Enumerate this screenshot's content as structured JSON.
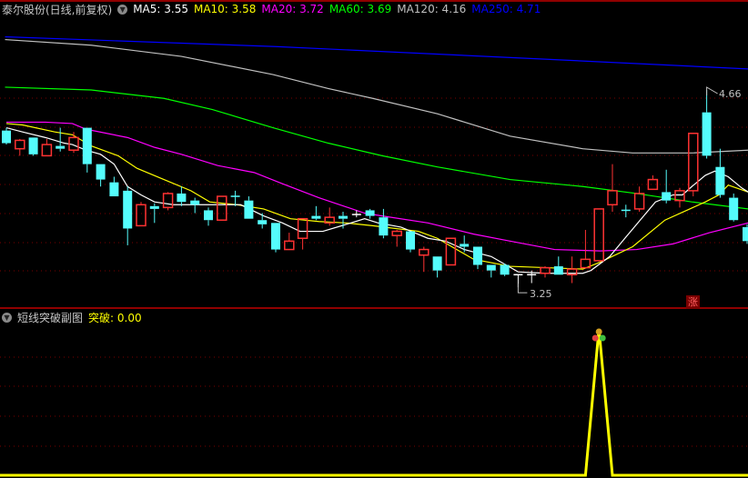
{
  "header": {
    "title": "泰尔股份(日线,前复权)",
    "indicators": [
      {
        "label": "MA5: 3.55",
        "color": "#FFFFFF"
      },
      {
        "label": "MA10: 3.58",
        "color": "#FFFF00"
      },
      {
        "label": "MA20: 3.72",
        "color": "#FF00FF"
      },
      {
        "label": "MA60: 3.69",
        "color": "#00FF00"
      },
      {
        "label": "MA120: 4.16",
        "color": "#C0C0C0"
      },
      {
        "label": "MA250: 4.71",
        "color": "#0000FF"
      }
    ]
  },
  "sub_panel": {
    "title": "短线突破副图",
    "value_label": "突破: 0.00",
    "value_color": "#FFFF00"
  },
  "annotations": {
    "high_label": "4.66",
    "low_label": "3.25",
    "rise_badge": "涨"
  },
  "colors": {
    "up": "#FF3232",
    "down": "#54FCFC",
    "doji": "#FFFFFF",
    "grid": "#7a0000",
    "separator": "#C00000"
  },
  "chart_data": {
    "type": "candlestick",
    "price_range": [
      3.25,
      4.66
    ],
    "candles": [
      [
        4.37,
        4.39,
        4.27,
        4.28
      ],
      [
        4.24,
        4.31,
        4.19,
        4.3
      ],
      [
        4.32,
        4.32,
        4.19,
        4.2
      ],
      [
        4.19,
        4.31,
        4.19,
        4.27
      ],
      [
        4.26,
        4.39,
        4.22,
        4.24
      ],
      [
        4.23,
        4.36,
        4.21,
        4.32
      ],
      [
        4.39,
        4.39,
        4.07,
        4.13
      ],
      [
        4.13,
        4.13,
        3.97,
        4.02
      ],
      [
        4.0,
        4.04,
        3.9,
        3.9
      ],
      [
        3.94,
        3.97,
        3.55,
        3.67
      ],
      [
        3.69,
        3.86,
        3.69,
        3.84
      ],
      [
        3.83,
        3.85,
        3.71,
        3.81
      ],
      [
        3.82,
        3.93,
        3.8,
        3.92
      ],
      [
        3.92,
        3.97,
        3.83,
        3.86
      ],
      [
        3.87,
        3.89,
        3.78,
        3.84
      ],
      [
        3.8,
        3.82,
        3.69,
        3.73
      ],
      [
        3.73,
        3.9,
        3.73,
        3.9
      ],
      [
        3.9,
        3.94,
        3.83,
        3.9
      ],
      [
        3.87,
        3.9,
        3.74,
        3.74
      ],
      [
        3.73,
        3.78,
        3.67,
        3.7
      ],
      [
        3.71,
        3.71,
        3.5,
        3.52
      ],
      [
        3.52,
        3.64,
        3.52,
        3.58
      ],
      [
        3.6,
        3.74,
        3.52,
        3.74
      ],
      [
        3.76,
        3.83,
        3.73,
        3.74
      ],
      [
        3.71,
        3.82,
        3.69,
        3.75
      ],
      [
        3.76,
        3.79,
        3.67,
        3.74
      ],
      [
        3.77,
        3.8,
        3.75,
        3.77
      ],
      [
        3.8,
        3.81,
        3.74,
        3.76
      ],
      [
        3.75,
        3.81,
        3.6,
        3.62
      ],
      [
        3.62,
        3.66,
        3.54,
        3.65
      ],
      [
        3.65,
        3.65,
        3.5,
        3.52
      ],
      [
        3.48,
        3.54,
        3.36,
        3.52
      ],
      [
        3.47,
        3.47,
        3.32,
        3.37
      ],
      [
        3.41,
        3.6,
        3.41,
        3.6
      ],
      [
        3.56,
        3.62,
        3.5,
        3.54
      ],
      [
        3.54,
        3.54,
        3.38,
        3.41
      ],
      [
        3.41,
        3.41,
        3.32,
        3.37
      ],
      [
        3.41,
        3.42,
        3.33,
        3.34
      ],
      [
        3.34,
        3.34,
        3.25,
        3.34
      ],
      [
        3.34,
        3.37,
        3.28,
        3.34
      ],
      [
        3.35,
        3.4,
        3.32,
        3.39
      ],
      [
        3.4,
        3.47,
        3.34,
        3.34
      ],
      [
        3.34,
        3.47,
        3.28,
        3.38
      ],
      [
        3.39,
        3.66,
        3.39,
        3.45
      ],
      [
        3.44,
        3.81,
        3.44,
        3.81
      ],
      [
        3.84,
        4.13,
        3.79,
        3.94
      ],
      [
        3.8,
        3.84,
        3.75,
        3.8
      ],
      [
        3.81,
        3.97,
        3.79,
        3.92
      ],
      [
        3.95,
        4.05,
        3.95,
        4.02
      ],
      [
        3.93,
        4.09,
        3.85,
        3.87
      ],
      [
        3.87,
        3.96,
        3.82,
        3.94
      ],
      [
        3.94,
        4.35,
        3.9,
        4.35
      ],
      [
        4.5,
        4.66,
        4.17,
        4.19
      ],
      [
        4.11,
        4.24,
        3.89,
        3.91
      ],
      [
        3.89,
        3.92,
        3.72,
        3.73
      ],
      [
        3.68,
        3.7,
        3.56,
        3.58
      ]
    ],
    "ma_lines": [
      {
        "name": "MA250",
        "color": "#0000FF",
        "points": [
          [
            -0.1,
            5.04
          ],
          [
            20,
            4.97
          ],
          [
            40,
            4.88
          ],
          [
            55.1,
            4.81
          ]
        ]
      },
      {
        "name": "MA120",
        "color": "#C0C0C0",
        "points": [
          [
            -0.1,
            5.02
          ],
          [
            6.3,
            4.98
          ],
          [
            13.0,
            4.9
          ],
          [
            19.8,
            4.77
          ],
          [
            23.9,
            4.67
          ],
          [
            27.2,
            4.6
          ],
          [
            32.0,
            4.49
          ],
          [
            37.4,
            4.33
          ],
          [
            42.8,
            4.24
          ],
          [
            46.5,
            4.21
          ],
          [
            50.9,
            4.21
          ],
          [
            55.1,
            4.23
          ]
        ]
      },
      {
        "name": "MA60",
        "color": "#00FF00",
        "points": [
          [
            -0.1,
            4.68
          ],
          [
            6.3,
            4.66
          ],
          [
            11.7,
            4.6
          ],
          [
            15.3,
            4.52
          ],
          [
            19.8,
            4.39
          ],
          [
            23.9,
            4.28
          ],
          [
            27.9,
            4.19
          ],
          [
            32.0,
            4.11
          ],
          [
            37.4,
            4.02
          ],
          [
            42.8,
            3.97
          ],
          [
            46.8,
            3.92
          ],
          [
            50.9,
            3.86
          ],
          [
            55.1,
            3.81
          ]
        ]
      },
      {
        "name": "MA20",
        "color": "#FF00FF",
        "points": [
          [
            0,
            4.43
          ],
          [
            2.9,
            4.43
          ],
          [
            4.9,
            4.42
          ],
          [
            5.9,
            4.38
          ],
          [
            9.0,
            4.32
          ],
          [
            11.0,
            4.25
          ],
          [
            13.0,
            4.2
          ],
          [
            15.7,
            4.12
          ],
          [
            18.4,
            4.07
          ],
          [
            20.5,
            3.99
          ],
          [
            23.2,
            3.89
          ],
          [
            26.6,
            3.78
          ],
          [
            27.9,
            3.76
          ],
          [
            31.3,
            3.71
          ],
          [
            34.7,
            3.63
          ],
          [
            37.4,
            3.58
          ],
          [
            40.7,
            3.52
          ],
          [
            44.1,
            3.51
          ],
          [
            46.8,
            3.52
          ],
          [
            49.5,
            3.56
          ],
          [
            52.2,
            3.64
          ],
          [
            55.1,
            3.71
          ]
        ]
      },
      {
        "name": "MA10",
        "color": "#FFFF00",
        "points": [
          [
            0,
            4.42
          ],
          [
            1.2,
            4.41
          ],
          [
            3.6,
            4.36
          ],
          [
            4.9,
            4.34
          ],
          [
            6.3,
            4.26
          ],
          [
            8.3,
            4.19
          ],
          [
            9.7,
            4.1
          ],
          [
            11.7,
            4.02
          ],
          [
            13.7,
            3.94
          ],
          [
            15.1,
            3.86
          ],
          [
            17.1,
            3.84
          ],
          [
            19.1,
            3.81
          ],
          [
            21.1,
            3.74
          ],
          [
            23.2,
            3.72
          ],
          [
            25.2,
            3.71
          ],
          [
            27.2,
            3.69
          ],
          [
            30.6,
            3.65
          ],
          [
            32.0,
            3.6
          ],
          [
            34.7,
            3.45
          ],
          [
            37.4,
            3.4
          ],
          [
            40.1,
            3.39
          ],
          [
            42.8,
            3.38
          ],
          [
            44.1,
            3.43
          ],
          [
            46.5,
            3.54
          ],
          [
            48.9,
            3.73
          ],
          [
            51.9,
            3.86
          ],
          [
            52.9,
            3.91
          ],
          [
            53.6,
            3.98
          ],
          [
            55.1,
            3.93
          ]
        ]
      },
      {
        "name": "MA5",
        "color": "#FFFFFF",
        "points": [
          [
            0,
            4.39
          ],
          [
            1.2,
            4.36
          ],
          [
            2.9,
            4.32
          ],
          [
            4.3,
            4.28
          ],
          [
            4.9,
            4.27
          ],
          [
            5.9,
            4.23
          ],
          [
            7.0,
            4.2
          ],
          [
            8.0,
            4.13
          ],
          [
            9.0,
            3.97
          ],
          [
            10.0,
            3.91
          ],
          [
            11.0,
            3.86
          ],
          [
            12.4,
            3.84
          ],
          [
            13.7,
            3.84
          ],
          [
            14.7,
            3.84
          ],
          [
            16.1,
            3.84
          ],
          [
            17.4,
            3.84
          ],
          [
            19.1,
            3.76
          ],
          [
            20.5,
            3.71
          ],
          [
            21.8,
            3.65
          ],
          [
            23.5,
            3.65
          ],
          [
            24.9,
            3.69
          ],
          [
            26.6,
            3.74
          ],
          [
            27.6,
            3.71
          ],
          [
            29.3,
            3.68
          ],
          [
            31.3,
            3.6
          ],
          [
            32.6,
            3.58
          ],
          [
            34.0,
            3.52
          ],
          [
            36.0,
            3.47
          ],
          [
            38.0,
            3.36
          ],
          [
            40.1,
            3.35
          ],
          [
            42.8,
            3.35
          ],
          [
            43.4,
            3.37
          ],
          [
            44.8,
            3.47
          ],
          [
            46.1,
            3.62
          ],
          [
            47.5,
            3.78
          ],
          [
            48.2,
            3.86
          ],
          [
            49.5,
            3.91
          ],
          [
            50.2,
            3.91
          ],
          [
            50.9,
            3.97
          ],
          [
            51.9,
            4.05
          ],
          [
            52.6,
            4.08
          ],
          [
            53.6,
            4.04
          ],
          [
            54.6,
            3.96
          ],
          [
            55.1,
            3.93
          ]
        ]
      }
    ],
    "breakout_signal": {
      "range": [
        0,
        1
      ],
      "spike_index": 44,
      "values_nonzero": [
        [
          44,
          1
        ]
      ]
    }
  }
}
